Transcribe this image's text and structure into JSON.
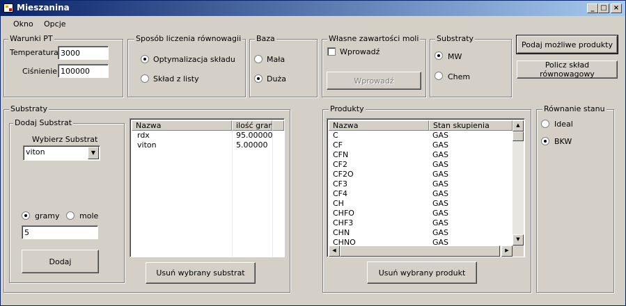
{
  "window": {
    "title": "Mieszanina",
    "minimize": "_",
    "maximize": "□",
    "close": "×"
  },
  "menu": [
    "Okno",
    "Opcje"
  ],
  "warunki": {
    "label": "Warunki PT",
    "temperature_label": "Temperatura",
    "temperature_value": "3000",
    "pressure_label": "Ciśnienie",
    "pressure_value": "100000"
  },
  "sposob": {
    "label": "Sposób liczenia równowagii",
    "opt1": "Optymalizacja składu",
    "opt2": "Skład z listy"
  },
  "baza": {
    "label": "Baza",
    "opt1": "Mała",
    "opt2": "Duża"
  },
  "wlasne": {
    "label": "Własne zawartości moli",
    "checkbox": "Wprowadź",
    "button": "Wprowadź"
  },
  "substraty_top": {
    "label": "Substraty",
    "opt1": "MW",
    "opt2": "Chem"
  },
  "buttons": {
    "podaj": "Podaj możliwe produkty",
    "policz": "Policz skład równowagowy"
  },
  "substraty": {
    "label": "Substraty",
    "dodaj_label": "Dodaj Substrat",
    "wybierz_label": "Wybierz Substrat",
    "combo_value": "viton",
    "unit1": "gramy",
    "unit2": "mole",
    "amount_value": "5",
    "add_button": "Dodaj",
    "columns": [
      "Nazwa",
      "ilość gram"
    ],
    "rows": [
      {
        "name": "rdx",
        "amount": "95.00000"
      },
      {
        "name": "viton",
        "amount": "5.00000"
      }
    ],
    "remove_button": "Usuń wybrany substrat"
  },
  "produkty": {
    "label": "Produkty",
    "columns": [
      "Nazwa",
      "Stan skupienia"
    ],
    "rows": [
      {
        "name": "C",
        "state": "GAS"
      },
      {
        "name": "CF",
        "state": "GAS"
      },
      {
        "name": "CFN",
        "state": "GAS"
      },
      {
        "name": "CF2",
        "state": "GAS"
      },
      {
        "name": "CF2O",
        "state": "GAS"
      },
      {
        "name": "CF3",
        "state": "GAS"
      },
      {
        "name": "CF4",
        "state": "GAS"
      },
      {
        "name": "CH",
        "state": "GAS"
      },
      {
        "name": "CHFO",
        "state": "GAS"
      },
      {
        "name": "CHF3",
        "state": "GAS"
      },
      {
        "name": "CHN",
        "state": "GAS"
      },
      {
        "name": "CHNO",
        "state": "GAS"
      }
    ],
    "remove_button": "Usuń wybrany produkt"
  },
  "rownanie": {
    "label": "Równanie stanu",
    "opt1": "Ideal",
    "opt2": "BKW"
  }
}
